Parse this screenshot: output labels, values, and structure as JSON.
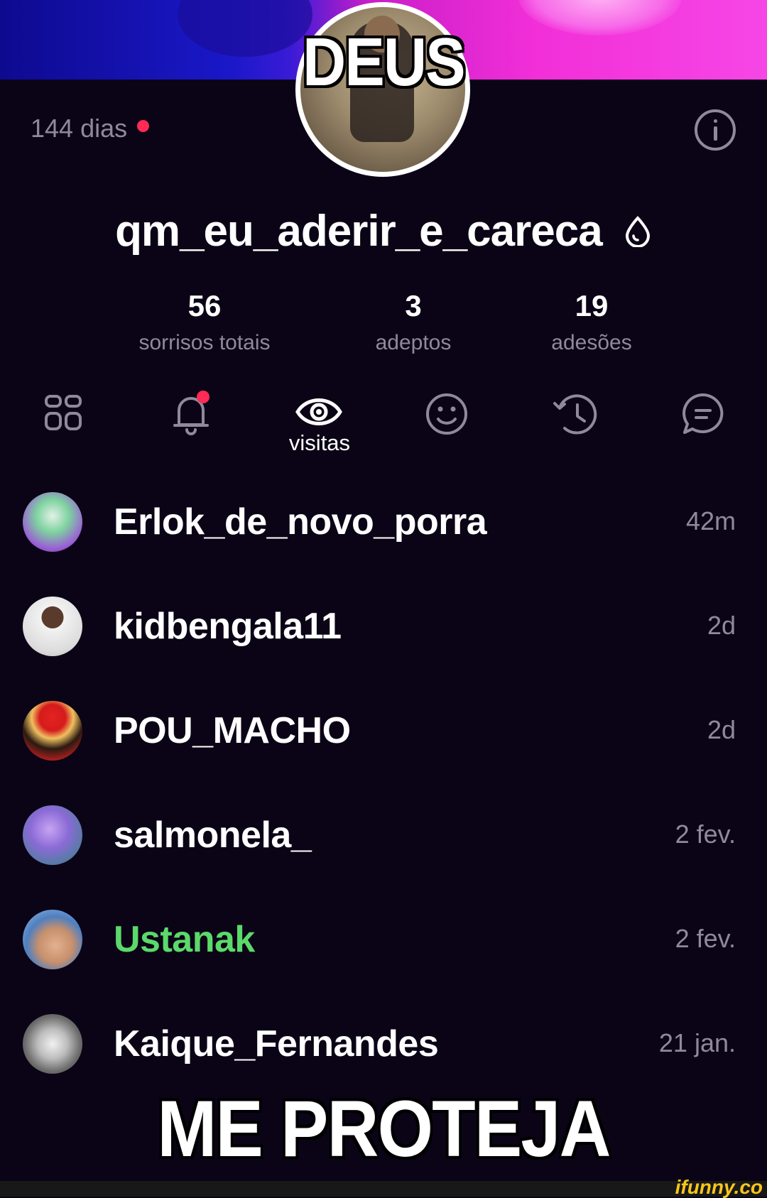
{
  "meme": {
    "top_text": "DEUS",
    "bottom_text": "ME PROTEJA"
  },
  "profile": {
    "days": "144 dias",
    "username": "qm_eu_aderir_e_careca",
    "badge_icon": "drop-icon",
    "stats": [
      {
        "value": "56",
        "label": "sorrisos totais"
      },
      {
        "value": "3",
        "label": "adeptos"
      },
      {
        "value": "19",
        "label": "adesões"
      }
    ]
  },
  "tabs": [
    {
      "icon": "grid-icon"
    },
    {
      "icon": "bell-icon",
      "has_dot": true
    },
    {
      "icon": "eye-icon",
      "label": "visitas",
      "active": true
    },
    {
      "icon": "smile-icon"
    },
    {
      "icon": "history-icon"
    },
    {
      "icon": "chat-icon"
    }
  ],
  "visits": [
    {
      "name": "Erlok_de_novo_porra",
      "time": "42m"
    },
    {
      "name": "kidbengala11",
      "time": "2d"
    },
    {
      "name": "POU_MACHO",
      "time": "2d"
    },
    {
      "name": "salmonela_",
      "time": "2 fev."
    },
    {
      "name": "Ustanak",
      "time": "2 fev.",
      "name_color": "#5bd96a"
    },
    {
      "name": "Kaique_Fernandes",
      "time": "21 jan."
    }
  ],
  "watermark": "ifunny.co",
  "colors": {
    "background": "#0b0416",
    "muted": "#8e8a9c",
    "accent_dot": "#ff2a55",
    "highlight_name": "#5bd96a"
  }
}
